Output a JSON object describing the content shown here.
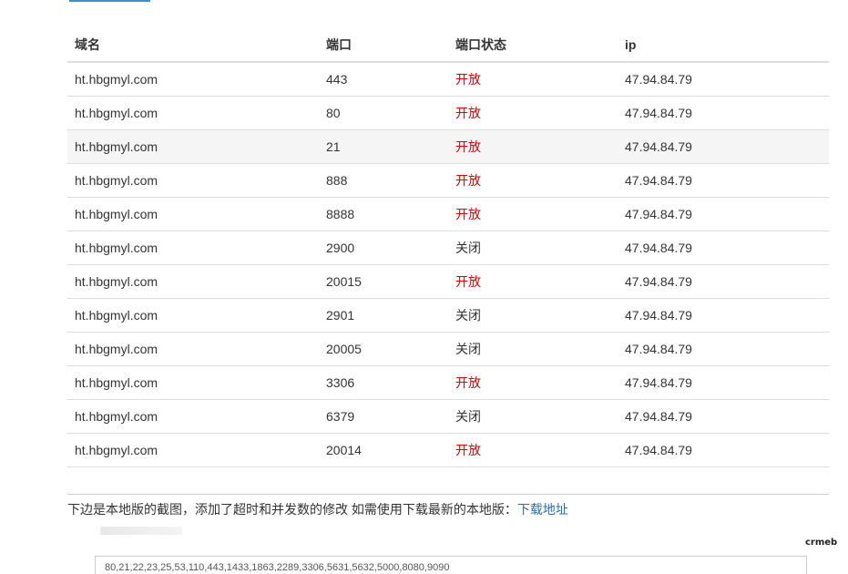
{
  "table": {
    "headers": [
      "域名",
      "端口",
      "端口状态",
      "ip"
    ],
    "rows": [
      {
        "domain": "ht.hbgmyl.com",
        "port": "443",
        "state": "开放",
        "ip": "47.94.84.79"
      },
      {
        "domain": "ht.hbgmyl.com",
        "port": "80",
        "state": "开放",
        "ip": "47.94.84.79"
      },
      {
        "domain": "ht.hbgmyl.com",
        "port": "21",
        "state": "开放",
        "ip": "47.94.84.79"
      },
      {
        "domain": "ht.hbgmyl.com",
        "port": "888",
        "state": "开放",
        "ip": "47.94.84.79"
      },
      {
        "domain": "ht.hbgmyl.com",
        "port": "8888",
        "state": "开放",
        "ip": "47.94.84.79"
      },
      {
        "domain": "ht.hbgmyl.com",
        "port": "2900",
        "state": "关闭",
        "ip": "47.94.84.79"
      },
      {
        "domain": "ht.hbgmyl.com",
        "port": "20015",
        "state": "开放",
        "ip": "47.94.84.79"
      },
      {
        "domain": "ht.hbgmyl.com",
        "port": "2901",
        "state": "关闭",
        "ip": "47.94.84.79"
      },
      {
        "domain": "ht.hbgmyl.com",
        "port": "20005",
        "state": "关闭",
        "ip": "47.94.84.79"
      },
      {
        "domain": "ht.hbgmyl.com",
        "port": "3306",
        "state": "开放",
        "ip": "47.94.84.79"
      },
      {
        "domain": "ht.hbgmyl.com",
        "port": "6379",
        "state": "关闭",
        "ip": "47.94.84.79"
      },
      {
        "domain": "ht.hbgmyl.com",
        "port": "20014",
        "state": "开放",
        "ip": "47.94.84.79"
      }
    ],
    "open_label": "开放"
  },
  "note": {
    "text": "下边是本地版的截图，添加了超时和并发数的修改 如需使用下载最新的本地版：",
    "link": "下载地址"
  },
  "preview": {
    "ports_value": "80,21,22,23,25,53,110,443,1433,1863,2289,3306,5631,5632,5000,8080,9090"
  },
  "watermark": "crmeb",
  "colors": {
    "open": "#e00000",
    "link": "#2a6fb0",
    "hover_row": "#f5f5f5"
  }
}
